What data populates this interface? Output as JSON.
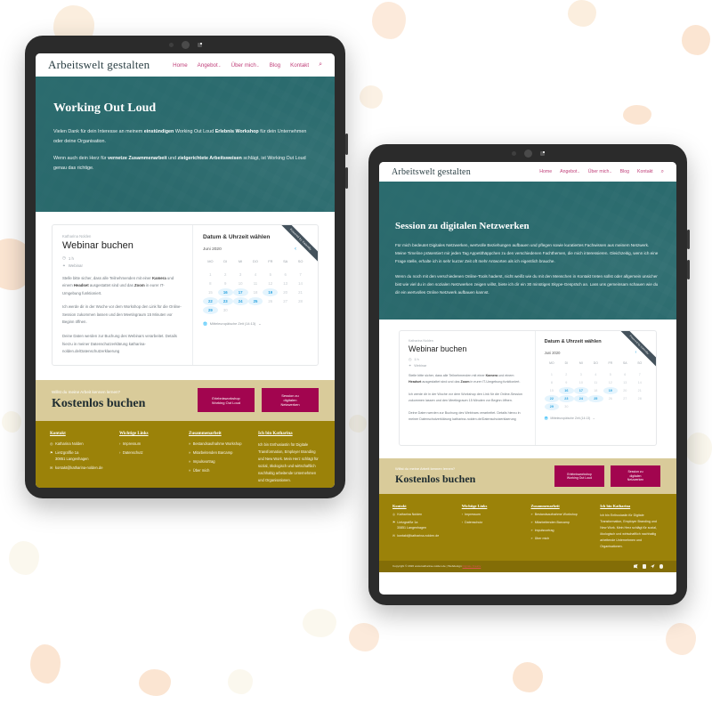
{
  "background": {
    "page_color": "#ffffff",
    "blob_color": "#fbe5d2",
    "blob_color_alt": "#fbf6e6"
  },
  "palette": {
    "teal": "#2b6b6e",
    "magenta": "#a2054f",
    "gold": "#9b8209",
    "sand": "#d9cb9a",
    "nav_pink": "#c0407a",
    "calendar_blue": "#2aa3e0"
  },
  "site": {
    "brand": "Arbeitswelt gestalten",
    "nav": [
      {
        "label": "Home",
        "caret": ""
      },
      {
        "label": "Angebot",
        "caret": "⌄"
      },
      {
        "label": "Über mich",
        "caret": "⌄"
      },
      {
        "label": "Blog",
        "caret": ""
      },
      {
        "label": "Kontakt",
        "caret": ""
      }
    ],
    "search_icon": "⌕"
  },
  "tablet1": {
    "hero": {
      "title": "Working Out Loud",
      "p1_a": "Vielen Dank für dein Interesse an meinem ",
      "p1_b": "einstündigen",
      "p1_c": " Working Out Loud ",
      "p1_d": "Erlebnis Workshop",
      "p1_e": " für dein Unternehmen oder deine Organisation.",
      "p2_a": "Wenn auch dein Herz für ",
      "p2_b": "vernetze Zusammenarbeit",
      "p2_c": " und ",
      "p2_d": "zielgerichtete Arbeitsweisen",
      "p2_e": " schlägt, ist Working Out Loud genau das richtige."
    }
  },
  "tablet2": {
    "hero": {
      "title": "Session zu digitalen Netzwerken",
      "p1": "Für mich bedeutet Digitales Netzwerken, wertvolle Beziehungen aufbauen und pflegen sowie kuratiertes Fachwissen aus meinem Netzwerk. Meine Timeline präsentiert mir jeden Tag Appetithäppchen zu den verschiedenen Fachthemen, die mich interessieren. Gleichzeitig, wenn ich eine Frage stelle, erhalte ich in sehr kurzer Zeit oft mehr Antworten als ich eigentlich brauche.",
      "p2": "Wenn du noch mit den verschiedenen Online-Tools haderst, nicht weißt wie du mit den Menschen in Kontakt treten sollst oder allgemein unsicher bist wie viel du in den sozialen Netzwerken zeigen willst, biete ich dir ein 30 minütiges Skype-Gespräch an. Lass uns gemeinsam schauen wie du dir ein wertvolles Online Netzwerk aufbauen kannst."
    }
  },
  "widget": {
    "ribbon": "Powered by Calendly",
    "host": "Katharina Nolden",
    "title": "Webinar buchen",
    "duration_icon": "ὕ2",
    "duration": "1 h",
    "location_icon": "⊙",
    "location": "Webinar",
    "para1_a": "Stelle bitte sicher, dass alle Teilnehmenden mit einer ",
    "para1_b": "Kamera",
    "para1_c": " und einem ",
    "para1_d": "Headset",
    "para1_e": " ausgestattet sind und das ",
    "para1_f": "Zoom",
    "para1_g": " in eurer IT-Umgebung funktioniert.",
    "para2": "Ich werde dir in der Woche vor dem Workshop den Link für die Online-Session zukommen lassen und den Meetingraum 15 Minuten vor Beginn öffnen.",
    "para3": "Deine Daten werden zur Buchung des Webinars verarbeitet. Details hierzu in meiner Datenschutzerklärung katharina-nolden.de/Datenschutzerklaerung",
    "calendar": {
      "heading": "Datum & Uhrzeit wählen",
      "month": "Juni 2020",
      "prev": "‹",
      "next": "›",
      "dow": [
        "MO",
        "DI",
        "MI",
        "DO",
        "FR",
        "SA",
        "SO"
      ],
      "leading_blanks": 0,
      "days": [
        1,
        2,
        3,
        4,
        5,
        6,
        7,
        8,
        9,
        10,
        11,
        12,
        13,
        14,
        15,
        16,
        17,
        18,
        19,
        20,
        21,
        22,
        23,
        24,
        25,
        26,
        27,
        28,
        29,
        30
      ],
      "available_days": [
        16,
        17,
        19,
        22,
        23,
        24,
        25,
        29
      ],
      "timezone_icon": "ἱ0",
      "timezone": "Mitteleuropäische Zeit (14:13)",
      "timezone_caret": "⌄"
    }
  },
  "cta": {
    "kicker": "Willst du meine Arbeit kennen lernen?",
    "title": "Kostenlos buchen",
    "buttons": [
      {
        "line1": "Erlebnisworkshop",
        "line2": "Working Out Loud",
        "line3": ""
      },
      {
        "line1": "Session zu",
        "line2": "digitalen",
        "line3": "Netzwerken"
      }
    ]
  },
  "footer": {
    "columns": [
      {
        "heading": "Kontakt",
        "items": [
          {
            "icon": "◎",
            "text": "Katharina Nolden"
          },
          {
            "icon": "⚑",
            "text": "Lietzgrafße 1a"
          },
          {
            "icon": "",
            "text": "30851 Langenhagen"
          },
          {
            "icon": "✉",
            "text": "kontakt@katharina-nolden.de"
          }
        ]
      },
      {
        "heading": "Wichtige Links",
        "items": [
          {
            "icon": "›",
            "text": "Impressum"
          },
          {
            "icon": "›",
            "text": "Datenschutz"
          }
        ]
      },
      {
        "heading": "Zusammenarbeit",
        "items": [
          {
            "icon": "»",
            "text": "Bestandsaufnahme Workshop"
          },
          {
            "icon": "»",
            "text": "Mitarbeitenden Barcamp"
          },
          {
            "icon": "»",
            "text": "Impulsvortrag"
          },
          {
            "icon": "»",
            "text": "Über mich"
          }
        ]
      }
    ],
    "about_heading": "Ich bin Katharina",
    "about_text": "Ich bin Enthusiastin für Digitale Transformation, Employer Branding und New Work. Mein Herz schlägt für sozial, ökologisch und wirtschaftlich nachhaltig arbeitende Unternehmen und Organisationen.",
    "bottom": {
      "copyright": "Copyright © 2020 www.katharina-nolden.de | Webdesign ",
      "credit": "Digitale Kreativ",
      "socials": [
        "twitter-icon",
        "instagram-icon",
        "telegram-icon",
        "xing-icon"
      ]
    }
  }
}
